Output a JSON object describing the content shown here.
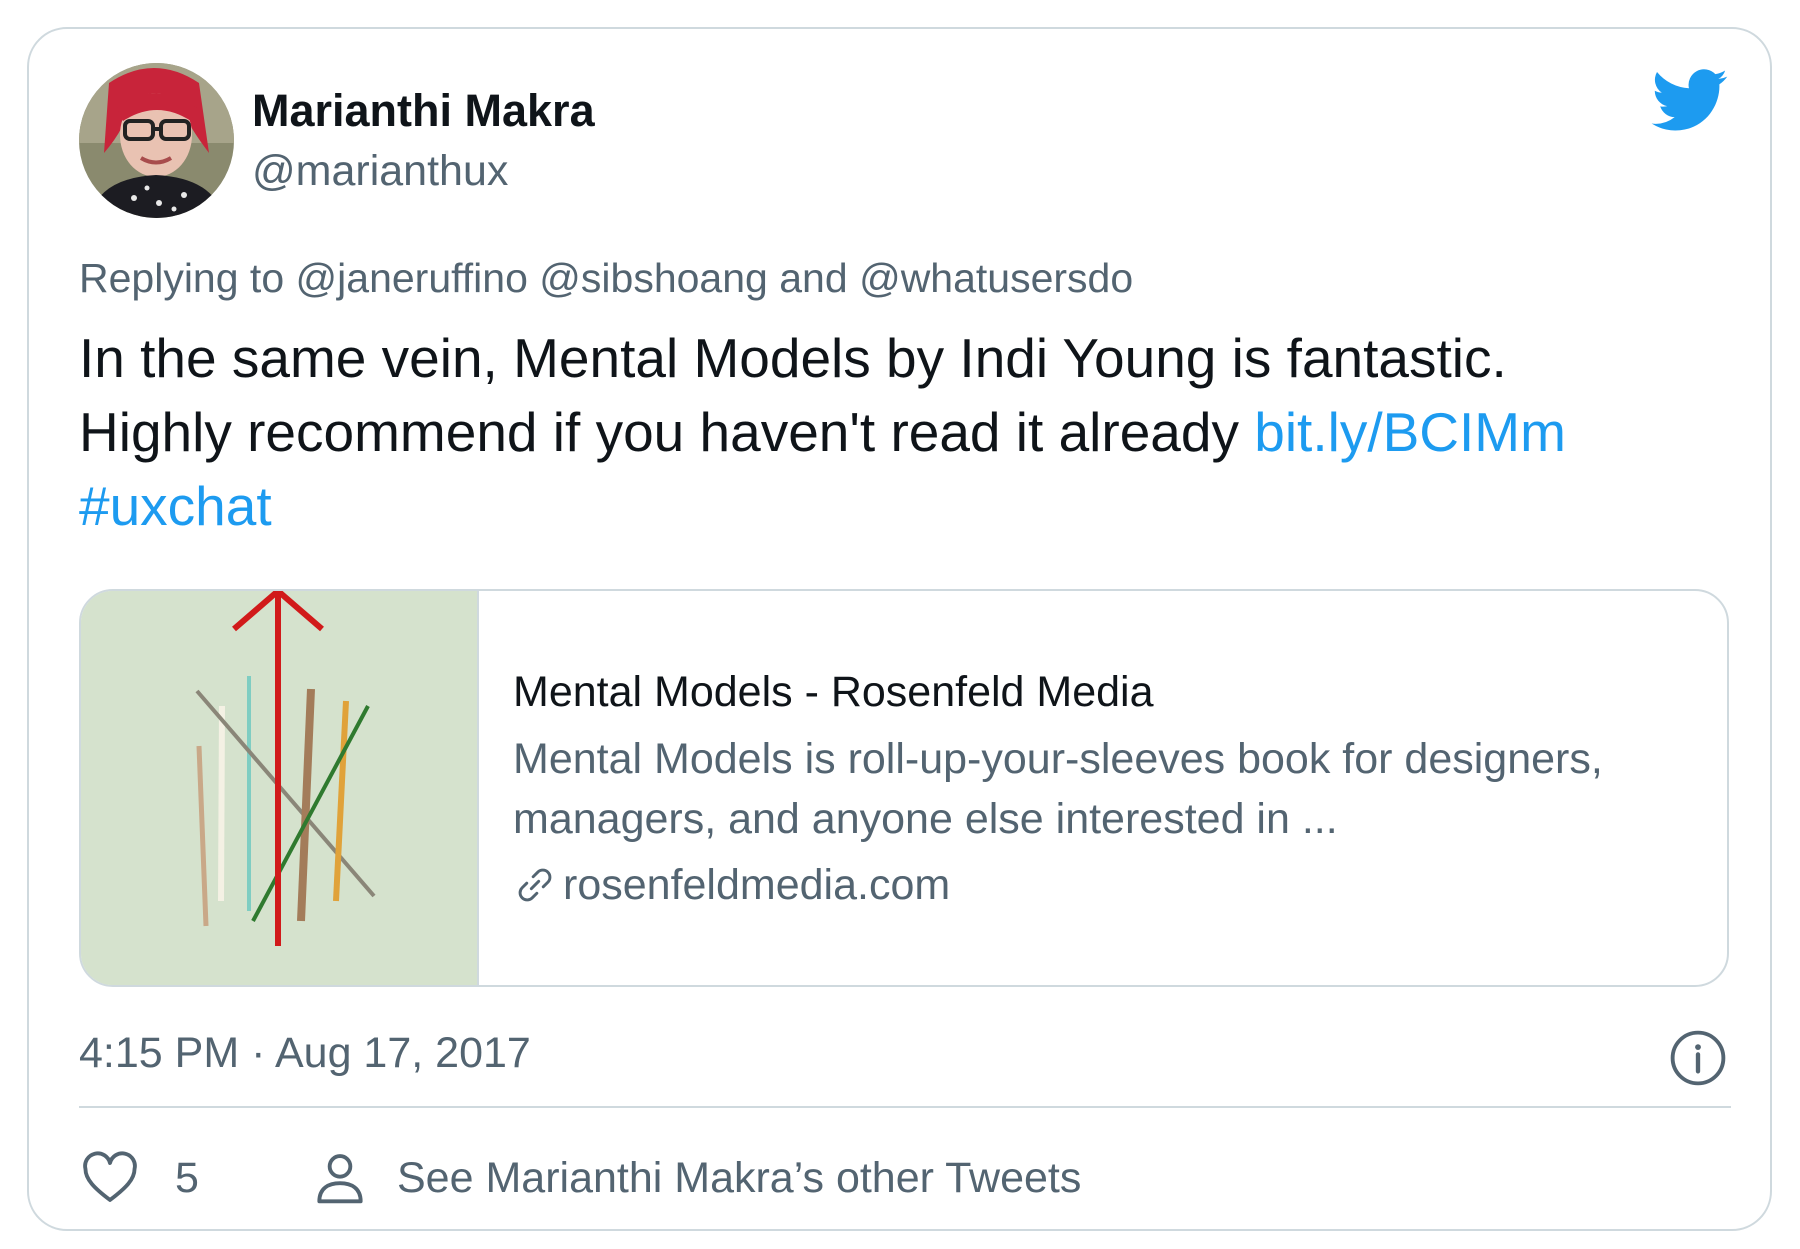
{
  "colors": {
    "link_blue": "#1d9bf0",
    "text_primary": "#0f1419",
    "text_secondary": "#536471",
    "border": "#cfd9de",
    "thumb_background": "#d5e2cd"
  },
  "tweet": {
    "author": {
      "name": "Marianthi Makra",
      "handle": "@marianthux",
      "avatar_icon": "profile-photo"
    },
    "brand_icon": "twitter-bird-icon",
    "reply": {
      "prefix": "Replying to",
      "mention_1": "@janeruffino",
      "mention_2": "@sibshoang",
      "conjunction": "and",
      "mention_3": "@whatusersdo"
    },
    "text_line_1": "In the same vein, Mental Models by Indi Young is fantastic.",
    "text_line_2": "Highly recommend if you haven't read it already",
    "link_text": "bit.ly/BCIMm",
    "hashtag": "#uxchat",
    "card": {
      "title": "Mental Models - Rosenfeld Media",
      "description": "Mental Models is roll-up-your-sleeves book for designers, managers, and anyone else interested in ...",
      "domain": "rosenfeldmedia.com",
      "domain_icon": "link-icon"
    },
    "timestamp": "4:15 PM · Aug 17, 2017",
    "info_icon": "info-icon",
    "actions": {
      "like_icon": "heart-icon",
      "like_count": "5",
      "profile_icon": "person-icon",
      "profile_label": "See Marianthi Makra’s other Tweets"
    }
  }
}
